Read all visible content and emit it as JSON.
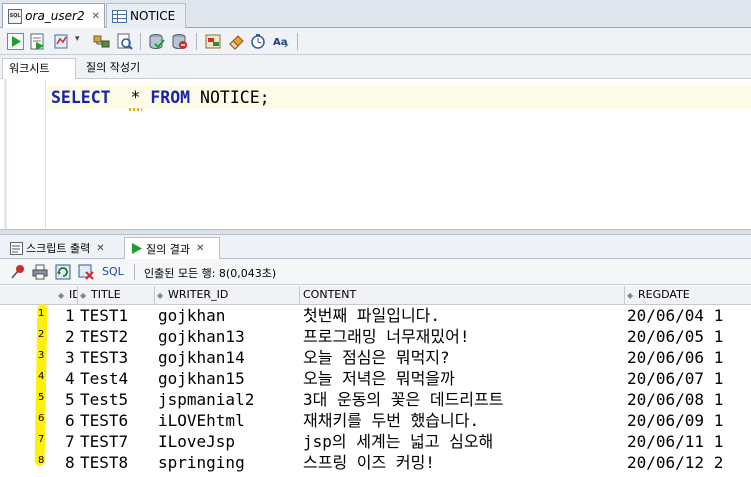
{
  "doc_tabs": [
    {
      "label": "ora_user2",
      "icon": "sql-worksheet-icon",
      "active": true
    },
    {
      "label": "NOTICE",
      "icon": "table-icon",
      "active": false
    }
  ],
  "editor_tabs": [
    {
      "label": "워크시트",
      "active": true
    },
    {
      "label": "질의 작성기",
      "active": false
    }
  ],
  "editor": {
    "kw_select": "SELECT",
    "star": "*",
    "kw_from": "FROM",
    "rest": "NOTICE;"
  },
  "result_tabs": [
    {
      "label": "스크립트 출력",
      "icon": "script-output-icon",
      "active": false
    },
    {
      "label": "질의 결과",
      "icon": "run-icon",
      "active": true
    }
  ],
  "result_toolbar": {
    "sql_link": "SQL",
    "separator": "|",
    "fetch_info": "인출된 모든 행: 8(0,043초)"
  },
  "grid": {
    "columns": [
      "ID",
      "TITLE",
      "WRITER_ID",
      "CONTENT",
      "REGDATE"
    ],
    "rows": [
      {
        "num": "1",
        "id": "1",
        "title": "TEST1",
        "writer": "gojkhan",
        "content": "첫번째 파일입니다.",
        "regdate": "20/06/04 1"
      },
      {
        "num": "2",
        "id": "2",
        "title": "TEST2",
        "writer": "gojkhan13",
        "content": "프로그래밍 너무재밌어!",
        "regdate": "20/06/05 1"
      },
      {
        "num": "3",
        "id": "3",
        "title": "TEST3",
        "writer": "gojkhan14",
        "content": "오늘 점심은 뭐먹지?",
        "regdate": "20/06/06 1"
      },
      {
        "num": "4",
        "id": "4",
        "title": "Test4",
        "writer": "gojkhan15",
        "content": "오늘 저녁은 뭐먹을까",
        "regdate": "20/06/07 1"
      },
      {
        "num": "5",
        "id": "5",
        "title": "Test5",
        "writer": "jspmanial2",
        "content": "3대 운동의 꽃은 데드리프트",
        "regdate": "20/06/08 1"
      },
      {
        "num": "6",
        "id": "6",
        "title": "TEST6",
        "writer": "iLOVEhtml",
        "content": "재채키를 두번 했습니다.",
        "regdate": "20/06/09 1"
      },
      {
        "num": "7",
        "id": "7",
        "title": "TEST7",
        "writer": "ILoveJsp",
        "content": "jsp의 세계는 넓고 심오해",
        "regdate": "20/06/11 1"
      },
      {
        "num": "8",
        "id": "8",
        "title": "TEST8",
        "writer": "springing",
        "content": "스프링 이즈 커밍!",
        "regdate": "20/06/12 2"
      }
    ]
  },
  "colors": {
    "keyword": "#1b21a8",
    "highlight_stroke": "#ffee00",
    "link": "#1c49a6"
  }
}
